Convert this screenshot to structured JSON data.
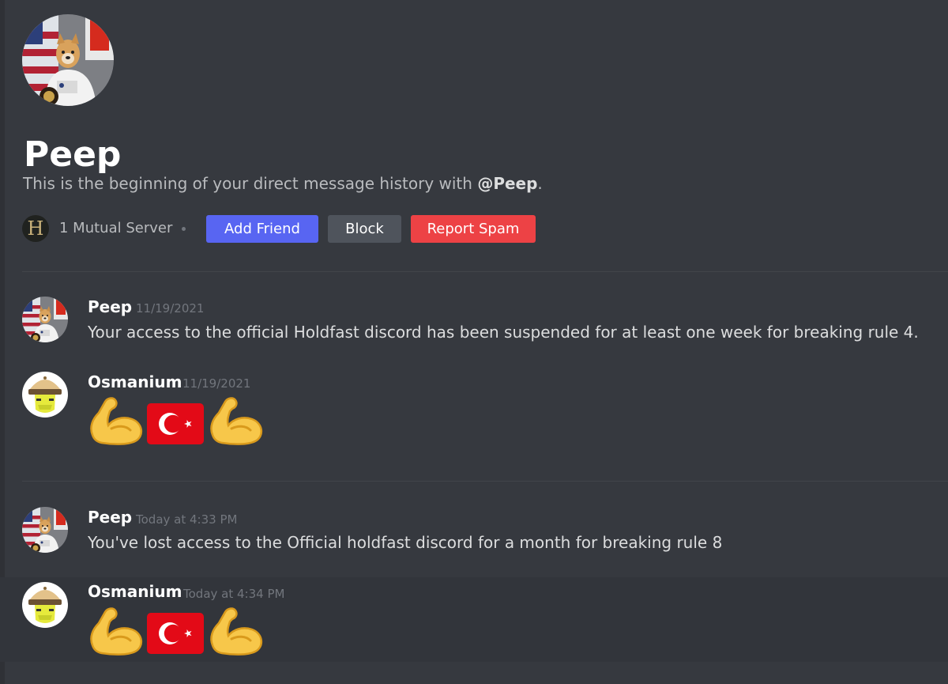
{
  "profile": {
    "name": "Peep",
    "intro_prefix": "This is the beginning of your direct message history with ",
    "intro_handle": "@Peep",
    "intro_suffix": ".",
    "mutual_server_icon_letter": "H",
    "mutual_servers_label": "1 Mutual Server"
  },
  "actions": {
    "add_friend": "Add Friend",
    "block": "Block",
    "report_spam": "Report Spam"
  },
  "messages": [
    {
      "author": "Peep",
      "timestamp": "11/19/2021",
      "text": "Your access to the official Holdfast discord has been suspended for at least one week for breaking rule 4."
    },
    {
      "author": "Osmanium",
      "timestamp": "11/19/2021",
      "emojis": [
        "flexed-biceps",
        "turkey-flag",
        "flexed-biceps"
      ]
    },
    {
      "author": "Peep",
      "timestamp": "Today at 4:33 PM",
      "text": "You've lost access to the Official holdfast discord for a month for breaking rule 8"
    },
    {
      "author": "Osmanium",
      "timestamp": "Today at 4:34 PM",
      "emojis": [
        "flexed-biceps",
        "turkey-flag",
        "flexed-biceps"
      ]
    }
  ],
  "colors": {
    "background": "#36393f",
    "blurple": "#5865f2",
    "grey_button": "#4f545c",
    "red_button": "#ed4245"
  }
}
